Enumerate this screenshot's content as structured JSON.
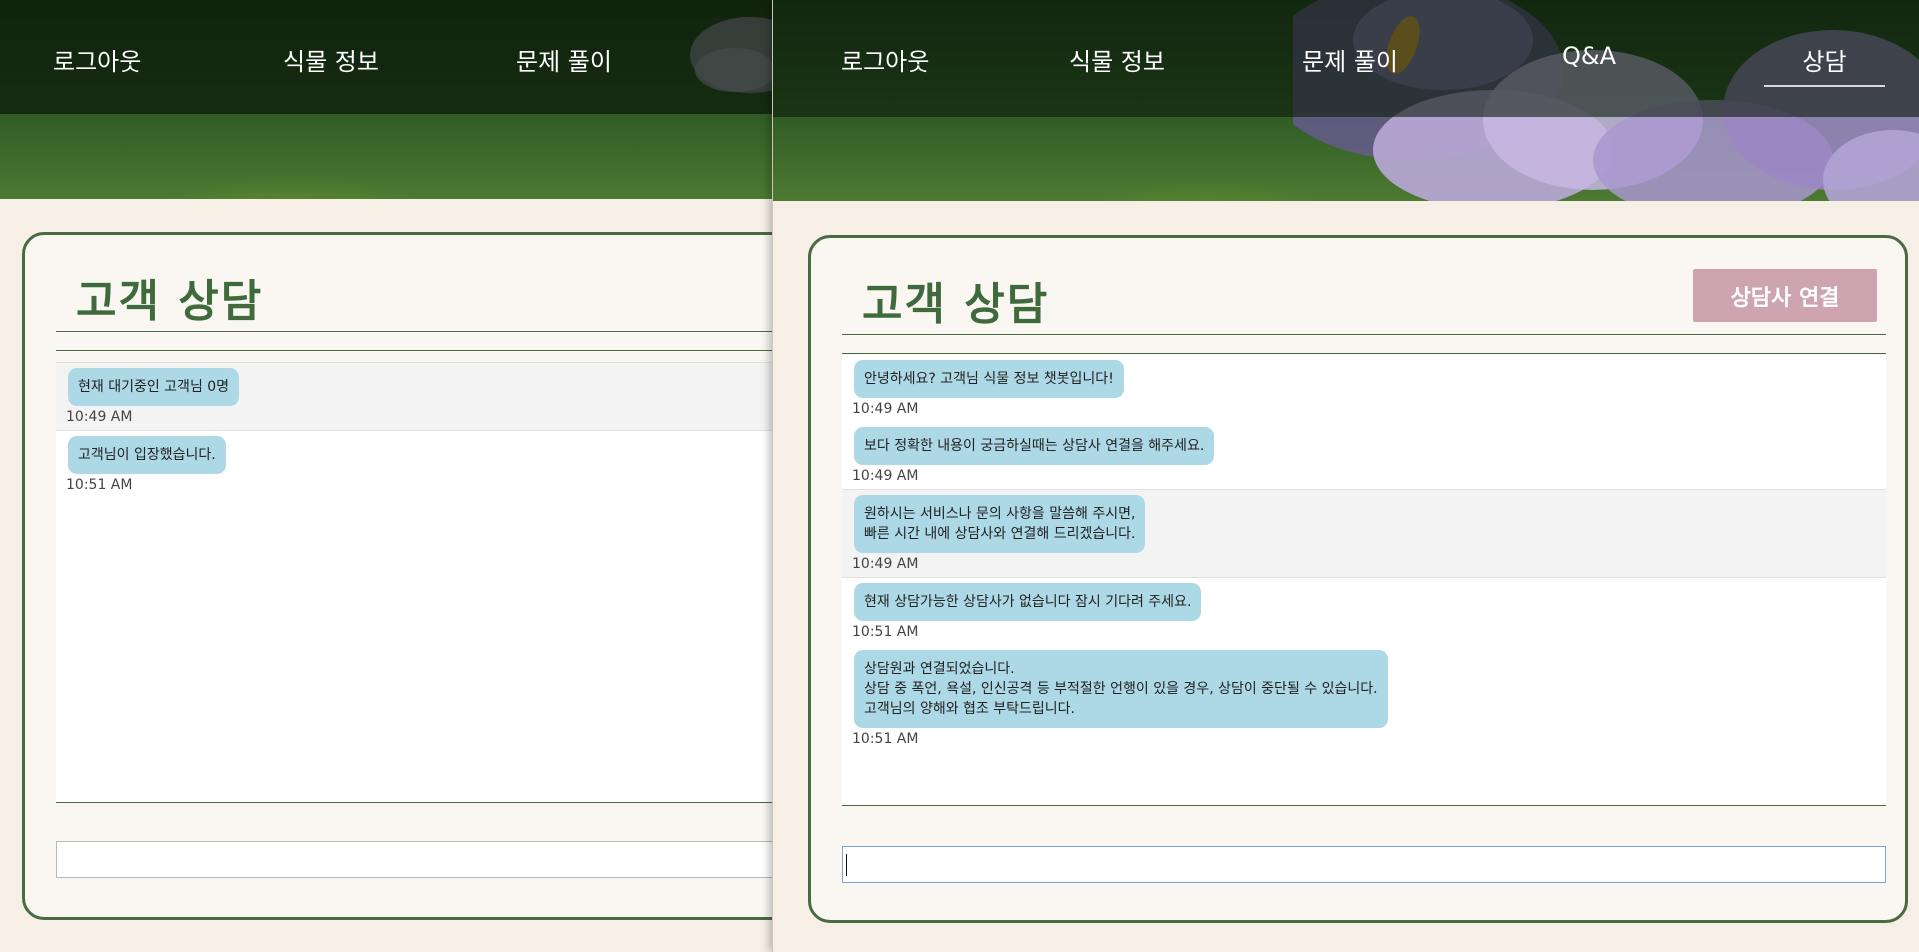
{
  "colors": {
    "nav_text": "#ffffff",
    "title": "#3e6a3c",
    "panel_border": "#4a6b42",
    "bubble": "#add8e6",
    "connect_button": "#cda4b0",
    "page_background": "#f5efe6"
  },
  "left_window": {
    "nav": {
      "logout": "로그아웃",
      "plant_info": "식물 정보",
      "quiz": "문제 풀이"
    },
    "title": "고객 상담",
    "messages": [
      {
        "text": "현재 대기중인 고객님 0명",
        "time": "10:49 AM"
      },
      {
        "text": "고객님이 입장했습니다.",
        "time": "10:51 AM"
      }
    ],
    "input": {
      "value": "",
      "placeholder": ""
    }
  },
  "right_window": {
    "nav": {
      "logout": "로그아웃",
      "plant_info": "식물 정보",
      "quiz": "문제 풀이",
      "qna": "Q&A",
      "consult": "상담"
    },
    "active_nav": "consult",
    "title": "고객 상담",
    "connect_button": "상담사 연결",
    "messages": [
      {
        "text": "안녕하세요? 고객님 식물 정보 챗봇입니다!",
        "time": "10:49 AM"
      },
      {
        "text": "보다 정확한 내용이 궁금하실때는 상담사 연결을 해주세요.",
        "time": "10:49 AM"
      },
      {
        "text": "원하시는 서비스나 문의 사항을 말씀해 주시면,\n빠른 시간 내에 상담사와 연결해 드리겠습니다.",
        "time": "10:49 AM"
      },
      {
        "text": "현재 상담가능한 상담사가 없습니다 잠시 기다려 주세요.",
        "time": "10:51 AM"
      },
      {
        "text": "상담원과 연결되었습니다.\n상담 중 폭언, 욕설, 인신공격 등 부적절한 언행이 있을 경우, 상담이 중단될 수 있습니다.\n고객님의 양해와 협조 부탁드립니다.",
        "time": "10:51 AM"
      }
    ],
    "input": {
      "value": "",
      "placeholder": ""
    }
  }
}
